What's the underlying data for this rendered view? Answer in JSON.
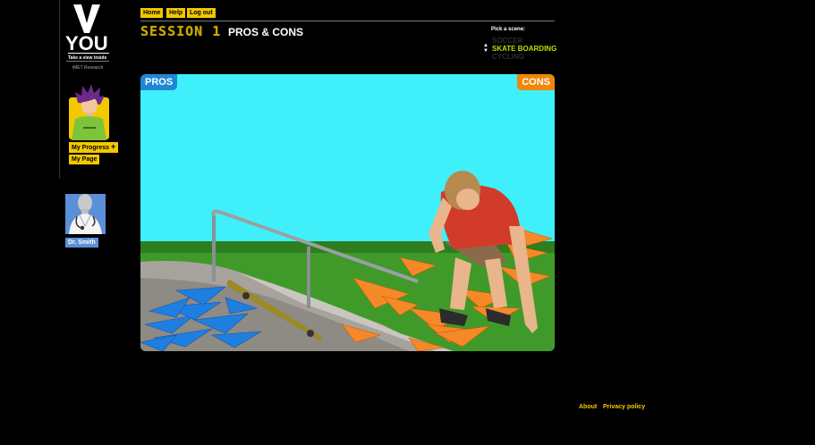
{
  "brand": {
    "logo_letter": "V",
    "logo_word": "YOU",
    "tagline": "Take a view inside",
    "research": "iMET Research"
  },
  "sidebar": {
    "my_progress": "My Progress",
    "progress_plus": "+",
    "my_page": "My Page",
    "doctor_name": "Dr. Smith"
  },
  "nav": {
    "home": "Home",
    "help": "Help",
    "logout": "Log out"
  },
  "header": {
    "session": "SESSION 1",
    "title": "PROS & CONS"
  },
  "scene_picker": {
    "label": "Pick a scene:",
    "options": [
      "SOCCER",
      "SKATE BOARDING",
      "CYCLING"
    ],
    "selected": "SKATE BOARDING"
  },
  "scene": {
    "pros_label": "PROS",
    "cons_label": "CONS"
  },
  "footer": {
    "about": "About",
    "privacy": "Privacy policy"
  },
  "colors": {
    "accent_yellow": "#f2c800",
    "selected_scene": "#b8e000",
    "pros_blue": "#1f87d6",
    "cons_orange": "#f0860a",
    "sky": "#3ff0fa"
  },
  "icons": [
    "doctor-stethoscope-icon",
    "scene-up-arrow-icon",
    "scene-down-arrow-icon",
    "plus-icon"
  ]
}
